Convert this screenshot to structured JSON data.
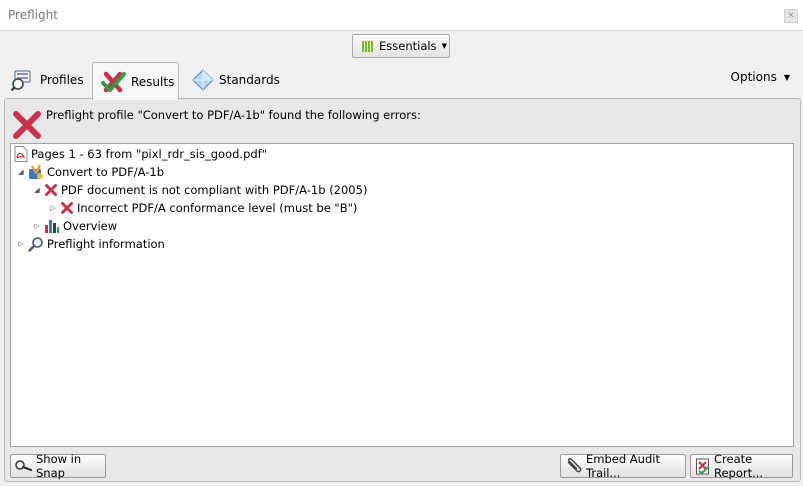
{
  "window": {
    "title": "Preflight"
  },
  "toolbar": {
    "workspace_label": "Essentials"
  },
  "tabs": [
    {
      "label": "Profiles",
      "icon": "profiles-icon"
    },
    {
      "label": "Results",
      "icon": "results-checkmark-icon",
      "selected": true
    },
    {
      "label": "Standards",
      "icon": "standards-diamond-icon"
    }
  ],
  "options_label": "Options",
  "result": {
    "message": "Preflight profile \"Convert to PDF/A-1b\" found the following errors:",
    "tree": [
      {
        "label": "Pages 1 - 63 from \"pixl_rdr_sis_good.pdf\"",
        "icon": "pdf-file-icon",
        "expanded": null
      },
      {
        "label": "Convert to PDF/A-1b",
        "icon": "profile-icon",
        "expanded": true
      },
      {
        "label": "PDF document is not compliant with PDF/A-1b (2005)",
        "icon": "error-x-icon",
        "expanded": true
      },
      {
        "label": "Incorrect PDF/A conformance level (must be \"B\")",
        "icon": "error-x-icon",
        "expanded": false
      },
      {
        "label": "Overview",
        "icon": "overview-chart-icon",
        "expanded": false
      },
      {
        "label": "Preflight information",
        "icon": "magnifier-icon",
        "expanded": false
      }
    ]
  },
  "buttons": {
    "show_in_snap": "Show in Snap",
    "embed_audit_trail": "Embed Audit Trail...",
    "create_report": "Create Report..."
  },
  "colors": {
    "error": "#c8324d",
    "accent_green": "#7eb52b",
    "background": "#f0f0f0"
  }
}
